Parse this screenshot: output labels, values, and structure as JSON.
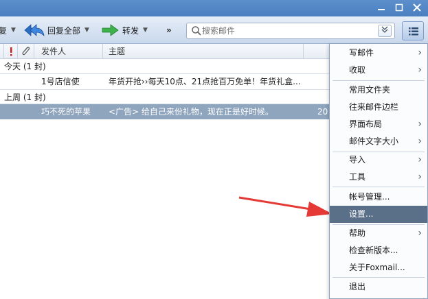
{
  "toolbar": {
    "reply_partial": "复",
    "reply_all": "回复全部",
    "forward": "转发",
    "more": "»"
  },
  "search": {
    "placeholder": "搜索邮件"
  },
  "columns": {
    "sender": "发件人",
    "subject": "主题"
  },
  "groups": [
    {
      "label": "今天 (1 封)"
    },
    {
      "label": "上周 (1 封)"
    }
  ],
  "mails": [
    {
      "sender": "1号店信使",
      "subject": "年货开抢››每天10点、21点抢百万免单！年货礼盒...",
      "date": ""
    },
    {
      "sender": "巧不死的苹果",
      "subject": "<广告> 给自己来份礼物，现在正是好时候。",
      "date": "20"
    }
  ],
  "menu": {
    "items": [
      {
        "label": "写邮件",
        "sub": true
      },
      {
        "label": "收取",
        "sub": true
      },
      {
        "label": "常用文件夹",
        "sub": false
      },
      {
        "label": "往来邮件边栏",
        "sub": false
      },
      {
        "label": "界面布局",
        "sub": true
      },
      {
        "label": "邮件文字大小",
        "sub": true
      },
      {
        "label": "导入",
        "sub": true
      },
      {
        "label": "工具",
        "sub": true
      },
      {
        "label": "帐号管理...",
        "sub": false
      },
      {
        "label": "设置...",
        "sub": false
      },
      {
        "label": "帮助",
        "sub": true
      },
      {
        "label": "检查新版本...",
        "sub": false
      },
      {
        "label": "关于Foxmail...",
        "sub": false
      },
      {
        "label": "退出",
        "sub": false
      }
    ],
    "chevron": "›"
  },
  "colors": {
    "accent": "#4a7fc0",
    "selected_row": "#8fa4bd",
    "menu_active": "#5a6f88",
    "arrow": "#e53935"
  }
}
